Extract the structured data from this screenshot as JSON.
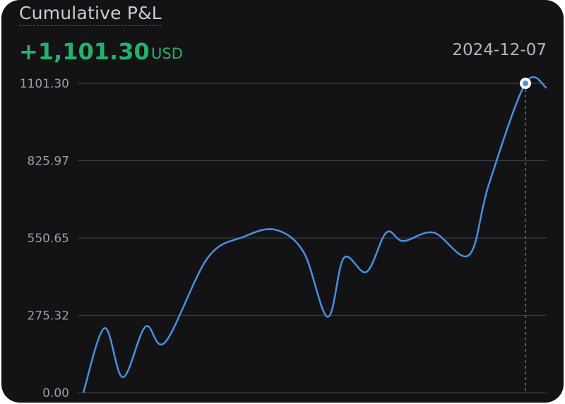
{
  "header": {
    "title": "Cumulative P&L",
    "pnl_value": "+1,101.30",
    "pnl_unit": "USD",
    "selected_date": "2024-12-07"
  },
  "colors": {
    "background": "#131316",
    "line": "#4a90e2",
    "positive": "#24b26b",
    "grid": "#3a3c43"
  },
  "chart_data": {
    "type": "line",
    "title": "Cumulative P&L",
    "xlabel": "",
    "ylabel": "",
    "ylim": [
      0,
      1101.3
    ],
    "y_ticks": [
      "0.00",
      "275.32",
      "550.65",
      "825.97",
      "1101.30"
    ],
    "grid": true,
    "highlight_point": {
      "x": 24,
      "y": 1101.3,
      "label": "2024-12-07"
    },
    "series": [
      {
        "values": [
          0,
          230,
          55,
          235,
          180,
          480,
          555,
          580,
          500,
          270,
          480,
          430,
          570,
          540,
          570,
          490,
          740,
          1101.3,
          1085
        ]
      }
    ],
    "x": [
      0,
      1,
      2,
      3,
      4,
      5,
      6,
      7,
      8,
      9,
      10,
      11,
      12,
      13,
      14,
      15,
      16,
      17,
      18
    ]
  }
}
